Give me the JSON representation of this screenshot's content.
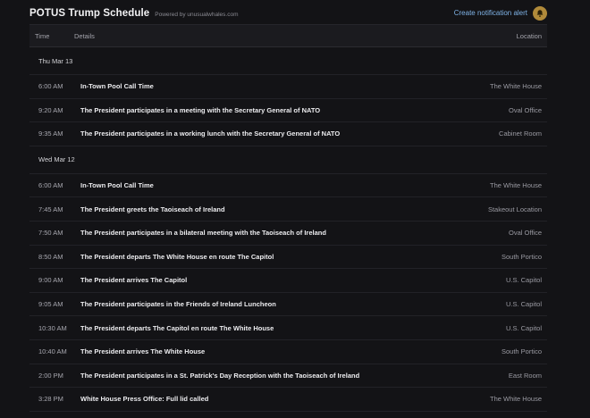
{
  "header": {
    "title": "POTUS Trump Schedule",
    "powered_by": "Powered by unusualwhales.com",
    "alert_link": "Create notification alert",
    "alert_icon": "bell-icon"
  },
  "table": {
    "columns": {
      "time": "Time",
      "details": "Details",
      "location": "Location"
    },
    "groups": [
      {
        "date": "Thu Mar 13",
        "events": [
          {
            "time": "6:00 AM",
            "details": "In-Town Pool Call Time",
            "location": "The White House"
          },
          {
            "time": "9:20 AM",
            "details": "The President participates in a meeting with the Secretary General of NATO",
            "location": "Oval Office"
          },
          {
            "time": "9:35 AM",
            "details": "The President participates in a working lunch with the Secretary General of NATO",
            "location": "Cabinet Room"
          }
        ]
      },
      {
        "date": "Wed Mar 12",
        "events": [
          {
            "time": "6:00 AM",
            "details": "In-Town Pool Call Time",
            "location": "The White House"
          },
          {
            "time": "7:45 AM",
            "details": "The President greets the Taoiseach of Ireland",
            "location": "Stakeout Location"
          },
          {
            "time": "7:50 AM",
            "details": "The President participates in a bilateral meeting with the Taoiseach of Ireland",
            "location": "Oval Office"
          },
          {
            "time": "8:50 AM",
            "details": "The President departs The White House en route The Capitol",
            "location": "South Portico"
          },
          {
            "time": "9:00 AM",
            "details": "The President arrives The Capitol",
            "location": "U.S. Capitol"
          },
          {
            "time": "9:05 AM",
            "details": "The President participates in the Friends of Ireland Luncheon",
            "location": "U.S. Capitol"
          },
          {
            "time": "10:30 AM",
            "details": "The President departs The Capitol en route The White House",
            "location": "U.S. Capitol"
          },
          {
            "time": "10:40 AM",
            "details": "The President arrives The White House",
            "location": "South Portico"
          },
          {
            "time": "2:00 PM",
            "details": "The President participates in a St. Patrick's Day Reception with the Taoiseach of Ireland",
            "location": "East Room"
          },
          {
            "time": "3:28 PM",
            "details": "White House Press Office: Full lid called",
            "location": "The White House"
          }
        ]
      }
    ]
  }
}
